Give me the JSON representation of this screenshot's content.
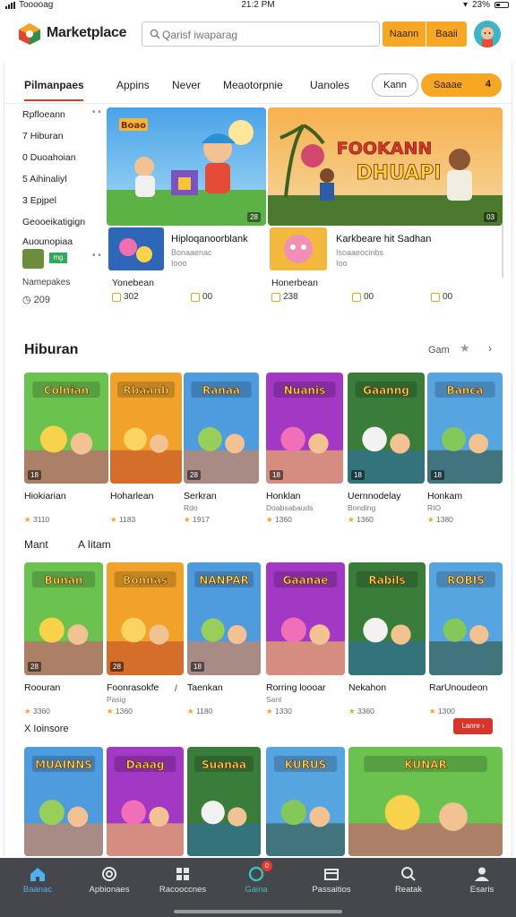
{
  "status": {
    "carrier": "Tooooag",
    "time": "21:2 PM",
    "battery": "23%"
  },
  "header": {
    "title": "Marketplace",
    "search_placeholder": "Qarisf iwaparag",
    "btn_one": "Naann",
    "btn_two": "Baaii"
  },
  "tabs": {
    "items": [
      "Pilmanpaes",
      "Appins",
      "Never",
      "Meaotorpnie",
      "Uanoles"
    ],
    "pill_outline": "Kann",
    "pill_orange": "Saaae",
    "pill_orange_count": "4"
  },
  "sidebar": {
    "items": [
      "Rpfloeann",
      "7 Hiburan",
      "0 Duoahoian",
      "5 Aihinaliyl",
      "3 Epjpel",
      "Geooeikatigign",
      "Auounopiaa"
    ],
    "tag": "mg",
    "stat_label": "Namepakes",
    "stat_value": "209"
  },
  "hero": {
    "a": {
      "count": "28",
      "sub_title": "Hiploqanoorblank",
      "sub_meta1": "Bonaaenac",
      "sub_meta2": "Iooo",
      "foot_label": "Yonebean",
      "stat1": "302",
      "stat2": "00",
      "art_text": "Boao"
    },
    "b": {
      "count": "03",
      "sub_title": "Karkbeare hit Sadhan",
      "sub_meta1": "Isoaaeocinbs",
      "sub_meta2": "Ioo",
      "foot_label": "Honerbean",
      "stat1": "238",
      "stat2": "00",
      "stat3": "00",
      "art_line1": "FOOKANN",
      "art_line2": "DHUAPI"
    }
  },
  "hiburan": {
    "title": "Hiburan",
    "right_label": "Gam",
    "tiles": [
      {
        "name": "Hiokiarian",
        "meta": "",
        "rating": "3110",
        "count": "18",
        "art": "Colnian"
      },
      {
        "name": "Hoharlean",
        "meta": "",
        "rating": "1183",
        "count": "",
        "art": "Rbaanb"
      },
      {
        "name": "Serkran",
        "meta": "Rdo",
        "rating": "1917",
        "count": "28",
        "art": "Ranaa"
      },
      {
        "name": "Honklan",
        "meta": "Doabsabauds",
        "rating": "1360",
        "count": "18",
        "art": "Nuanis"
      },
      {
        "name": "Uernnodelay",
        "meta": "Bonding",
        "rating": "1360",
        "count": "18",
        "art": "Gaanng"
      },
      {
        "name": "Honkam",
        "meta": "RIO",
        "rating": "1380",
        "count": "18",
        "art": "Banca"
      }
    ]
  },
  "more": {
    "label1": "Mant",
    "label2": "A Iitam",
    "tiles": [
      {
        "name": "Roouran",
        "meta": "",
        "rating": "3360",
        "count": "28",
        "art": "Bunan"
      },
      {
        "name": "Foonrasokfe",
        "meta": "Pasig",
        "rating": "1360",
        "count": "28",
        "art": "Bonnas"
      },
      {
        "name": "Taenkan",
        "meta": "",
        "rating": "1180",
        "count": "18",
        "art": "NANPAR"
      },
      {
        "name": "Rorring loooar",
        "meta": "Sanl",
        "rating": "1330",
        "count": "",
        "art": "Gaanae"
      },
      {
        "name": "Nekahon",
        "meta": "",
        "rating": "3360",
        "count": "",
        "art": "Rabils"
      },
      {
        "name": "RarUnoudeon",
        "meta": "",
        "rating": "1300",
        "count": "",
        "art": "ROBIS"
      }
    ],
    "extra_label": "X Ioinsore",
    "extra_badge": "Lanre",
    "slash": "/"
  },
  "bottom_tiles": [
    {
      "art": "MUAINNS"
    },
    {
      "art": "Daaag"
    },
    {
      "art": "Suanaa"
    },
    {
      "art": "KURUS"
    },
    {
      "art": "KUNAR"
    }
  ],
  "nav": {
    "items": [
      {
        "label": "Baanac"
      },
      {
        "label": "Apbionaes"
      },
      {
        "label": "Racooccnes"
      },
      {
        "label": "Gaina"
      },
      {
        "label": "Passaitios"
      },
      {
        "label": "Reatak"
      },
      {
        "label": "Esaris"
      }
    ],
    "badge": "0"
  },
  "colors": {
    "accent": "#f6a723",
    "tab_underline": "#d63a2a",
    "nav_bg": "#45474c",
    "nav_active": "#4fb1ee",
    "nav_teal": "#37c2c0",
    "star": "#f2a51a"
  }
}
